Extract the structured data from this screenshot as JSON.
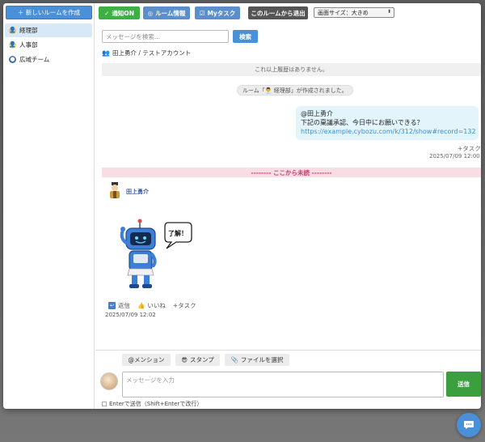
{
  "sidebar": {
    "new_room_label": "＋ 新しいルームを作成",
    "rooms": [
      {
        "label": "経理部",
        "icon": "person-icon",
        "active": true
      },
      {
        "label": "人事部",
        "icon": "person-icon",
        "active": false
      },
      {
        "label": "広域チーム",
        "icon": "globe-icon",
        "active": false
      }
    ]
  },
  "toolbar": {
    "notify_label": "通知ON",
    "room_info_label": "ルーム情報",
    "my_task_label": "Myタスク",
    "leave_label": "このルームから退出",
    "screen_size_label": "画面サイズ：大きめ"
  },
  "search": {
    "placeholder": "メッセージを検索...",
    "button_label": "検索"
  },
  "members_label": "田上勇介 / テストアカウント",
  "chat": {
    "no_history": "これ以上履歴はありません。",
    "room_created": "ルーム「👨‍💼 経理部」が作成されました。",
    "my_message": {
      "line1": "@田上勇介",
      "line2": "下記の稟議承認、今日中にお願いできる？",
      "link": "https://example.cybozu.com/k/312/show#record=132"
    },
    "my_task_label": "+タスク",
    "my_time": "2025/07/09 12:00",
    "unread_label": "-------- ここから未読 --------",
    "sender_name": "田上勇介",
    "stamp_text": "了解！",
    "actions": {
      "reply": "返信",
      "like": "いいね",
      "task": "+タスク"
    },
    "msg_time": "2025/07/09 12:02"
  },
  "composer": {
    "mention_label": "@メンション",
    "stamp_label": "スタンプ",
    "file_label": "ファイルを選択",
    "input_placeholder": "メッセージを入力",
    "send_label": "送信",
    "enter_option_label": "Enterで送信（Shift+Enterで改行）"
  },
  "colors": {
    "accent": "#4a90d9",
    "green": "#3cb043",
    "unread": "#d23a6e"
  }
}
